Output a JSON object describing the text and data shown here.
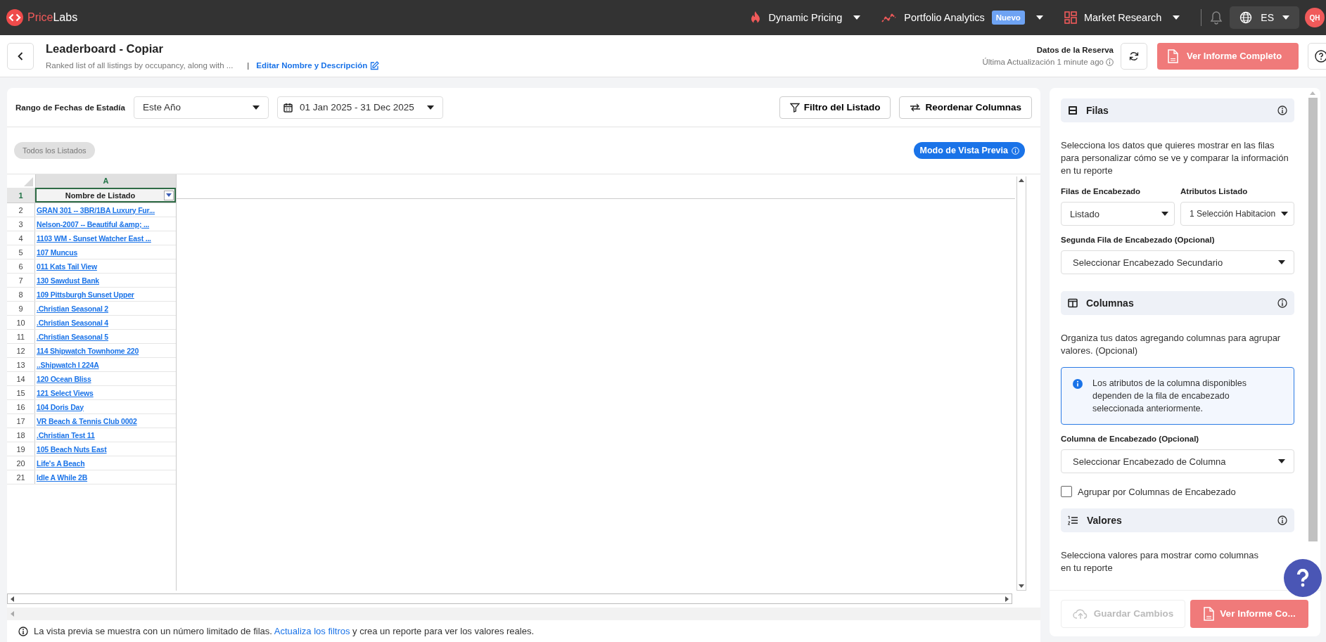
{
  "nav": {
    "brand": [
      {
        "text": "Price",
        "kind": "accent"
      },
      {
        "text": "Labs",
        "kind": "plain"
      }
    ],
    "menus": [
      {
        "label": "Dynamic Pricing"
      },
      {
        "label": "Portfolio Analytics",
        "badge": "Nuevo"
      },
      {
        "label": "Market Research"
      }
    ],
    "language": "ES",
    "avatar": "QH"
  },
  "header": {
    "title": "Leaderboard - Copiar",
    "description": "Ranked list of all listings by occupancy, along with ...",
    "separator": "|",
    "edit_link": "Editar Nombre y Descripción",
    "data_label": "Datos de la Reserva",
    "last_update": "Última Actualización 1 minute ago",
    "report_button": "Ver Informe Completo"
  },
  "toolbar": {
    "date_range_label": "Rango de Fechas de Estadía",
    "period": "Este Año",
    "dates": "01 Jan 2025 - 31 Dec 2025",
    "buttons": [
      "Filtro del Listado",
      "Reordenar Columnas"
    ]
  },
  "chip": "Todos los Listados",
  "preview_mode": "Modo de Vista Previa",
  "sheet": {
    "column_letter": "A",
    "header_row_number": "1",
    "header": "Nombre de Listado",
    "rows": [
      {
        "number": "2",
        "name": "GRAN 301 -- 3BR/1BA Luxury Fur..."
      },
      {
        "number": "3",
        "name": "Nelson-2007 -- Beautiful &amp; ..."
      },
      {
        "number": "4",
        "name": "1103 WM - Sunset Watcher East ..."
      },
      {
        "number": "5",
        "name": "107 Muncus"
      },
      {
        "number": "6",
        "name": "011 Kats Tail View"
      },
      {
        "number": "7",
        "name": "130 Sawdust Bank"
      },
      {
        "number": "8",
        "name": "109 Pittsburgh Sunset Upper"
      },
      {
        "number": "9",
        "name": ".Christian Seasonal 2"
      },
      {
        "number": "10",
        "name": ".Christian Seasonal 4"
      },
      {
        "number": "11",
        "name": ".Christian Seasonal 5"
      },
      {
        "number": "12",
        "name": "114 Shipwatch Townhome 220"
      },
      {
        "number": "13",
        "name": "..Shipwatch I 224A"
      },
      {
        "number": "14",
        "name": "120 Ocean Bliss"
      },
      {
        "number": "15",
        "name": "121 Select Views"
      },
      {
        "number": "16",
        "name": "104 Doris Day"
      },
      {
        "number": "17",
        "name": "VR Beach & Tennis Club 0002"
      },
      {
        "number": "18",
        "name": ".Christian Test 11"
      },
      {
        "number": "19",
        "name": "105 Beach Nuts East"
      },
      {
        "number": "20",
        "name": "Life's A Beach"
      },
      {
        "number": "21",
        "name": "Idle A While 2B"
      }
    ]
  },
  "footer_note": {
    "before": "La vista previa se muestra con un número limitado de filas.",
    "link": "Actualiza los filtros",
    "after": "y crea un reporte para ver los valores reales."
  },
  "panel": {
    "items": [
      {
        "kind": "section",
        "title": "Filas"
      },
      {
        "kind": "text",
        "text": "Selecciona los datos que quieres mostrar en las filas para personalizar cómo se ve y comparar la información en tu reporte"
      },
      {
        "kind": "fields",
        "fields": [
          {
            "label": "Filas de Encabezado",
            "value": "Listado"
          },
          {
            "label": "Atributos Listado",
            "value": "1 Selección Habitacion"
          }
        ]
      },
      {
        "kind": "field",
        "label": "Segunda Fila de Encabezado (Opcional)",
        "value": "Seleccionar Encabezado Secundario"
      },
      {
        "kind": "section",
        "title": "Columnas"
      },
      {
        "kind": "text",
        "text": "Organiza tus datos agregando columnas para agrupar valores. (Opcional)"
      },
      {
        "kind": "callout",
        "text": "Los atributos de la columna disponibles dependen de la fila de encabezado seleccionada anteriormente."
      },
      {
        "kind": "field",
        "label": "Columna de Encabezado (Opcional)",
        "value": "Seleccionar Encabezado de Columna"
      },
      {
        "kind": "checkbox",
        "label": "Agrupar por Columnas de Encabezado",
        "checked": false
      },
      {
        "kind": "section",
        "title": "Valores"
      },
      {
        "kind": "text",
        "text": "Selecciona valores para mostrar como columnas en tu reporte"
      }
    ],
    "buttons": [
      {
        "kind": "save",
        "label": "Guardar Cambios",
        "disabled": true
      },
      {
        "kind": "report",
        "label": "Ver Informe Co...",
        "disabled": false
      }
    ]
  }
}
